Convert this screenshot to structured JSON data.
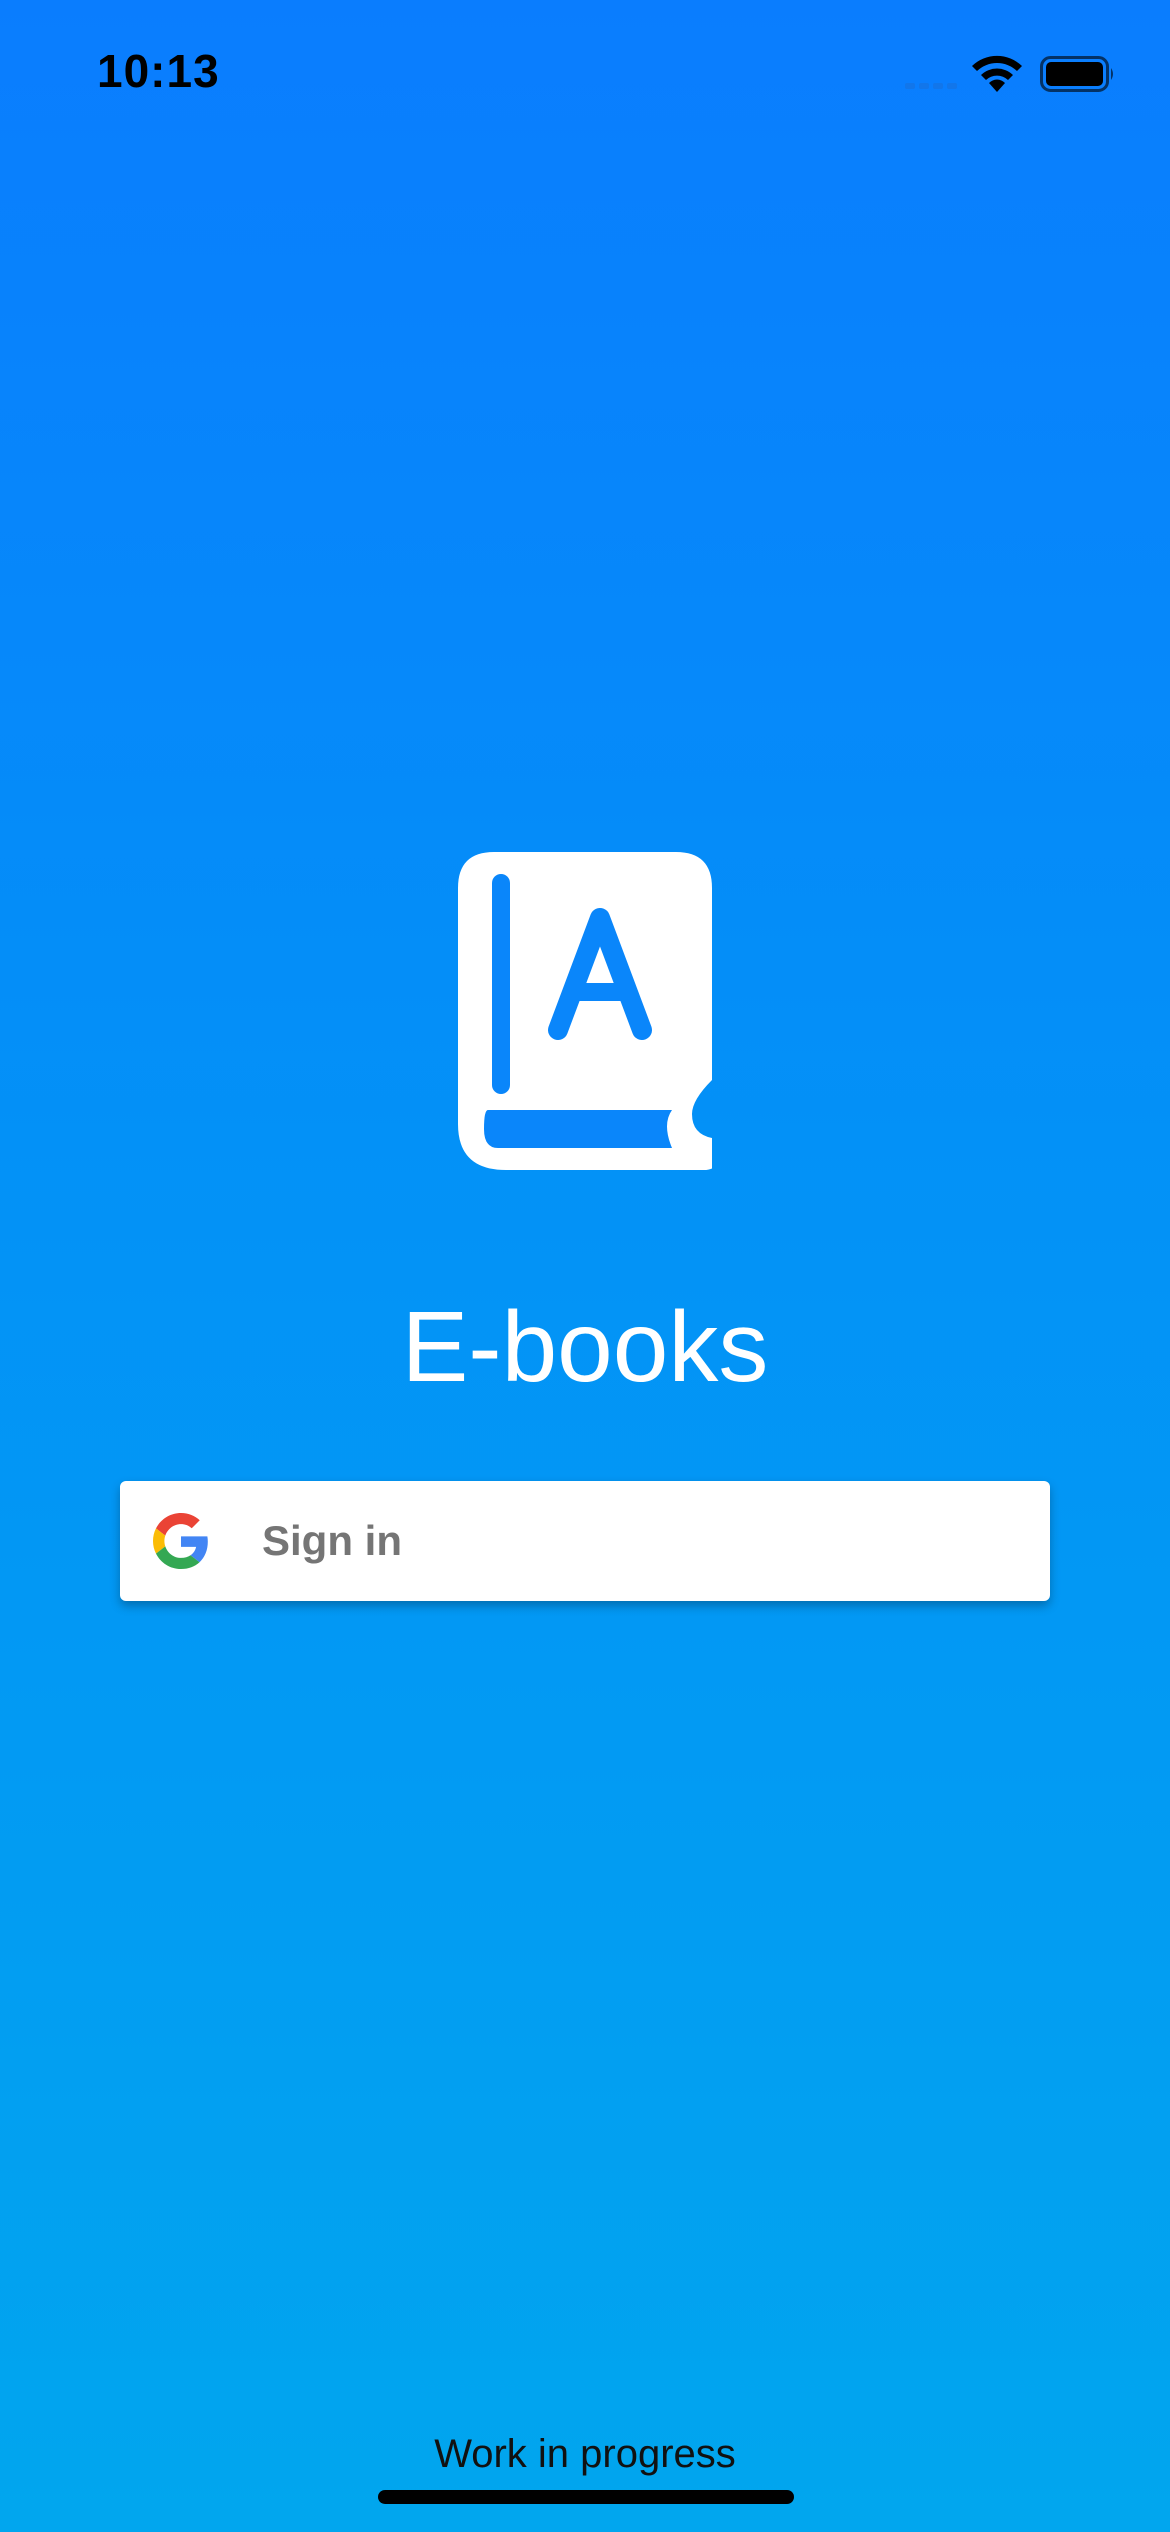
{
  "status_bar": {
    "time": "10:13",
    "icons": [
      "cellular-signal-icon",
      "wifi-icon",
      "battery-icon"
    ]
  },
  "logo": {
    "icon": "book-icon",
    "letter": "A"
  },
  "app": {
    "title": "E-books"
  },
  "signin": {
    "label": "Sign in",
    "icon": "google-logo-icon"
  },
  "footer": {
    "text": "Work in progress"
  },
  "colors": {
    "background_top": "#0A7DFE",
    "background_bottom": "#01A6EE",
    "button_background": "#FFFFFF",
    "button_text": "#757575",
    "google_blue": "#4285F4",
    "google_red": "#EA4335",
    "google_yellow": "#FBBC05",
    "google_green": "#34A853"
  }
}
